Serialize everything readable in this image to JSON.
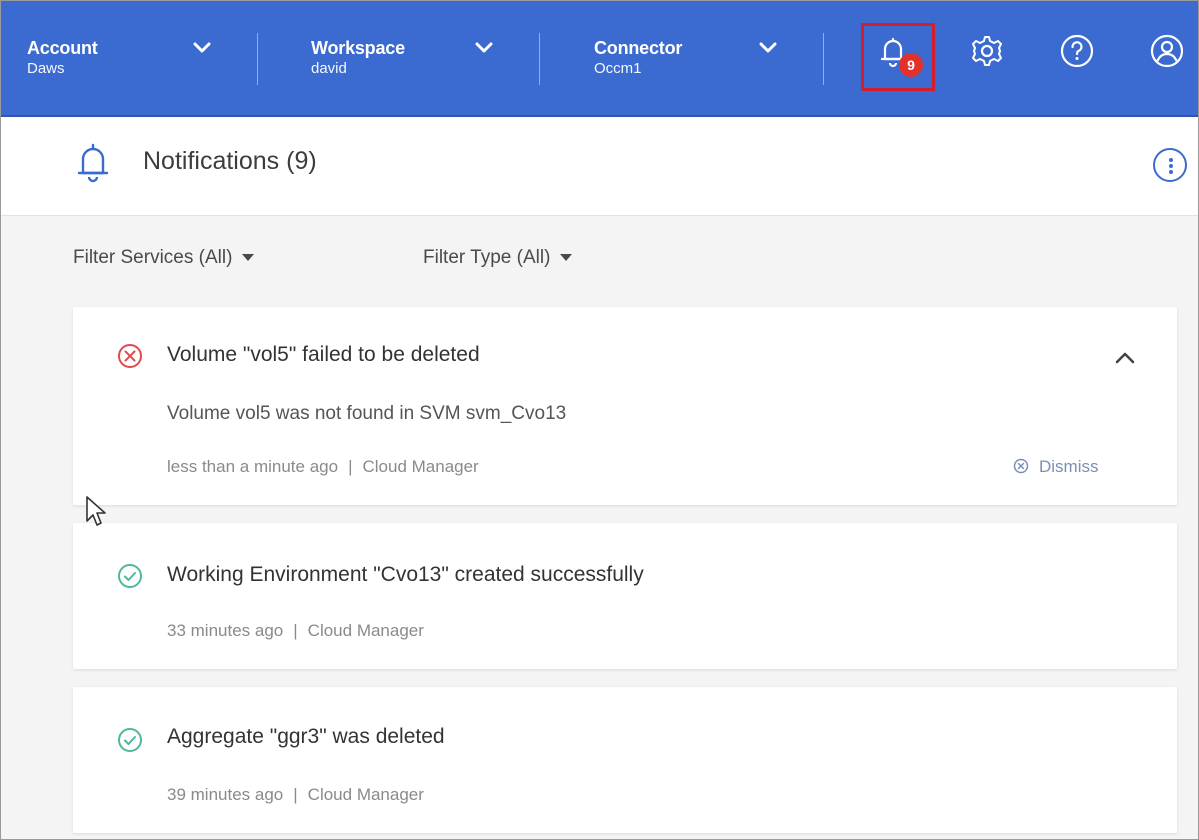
{
  "topbar": {
    "account": {
      "title": "Account",
      "value": "Daws"
    },
    "workspace": {
      "title": "Workspace",
      "value": "david"
    },
    "connector": {
      "title": "Connector",
      "value": "Occm1"
    },
    "notification_count": "9",
    "icons": [
      "bell-icon",
      "gear-icon",
      "help-icon",
      "user-icon"
    ],
    "bar_color": "#3b6bd1",
    "highlight_color": "#d21f2b"
  },
  "header": {
    "title": "Notifications (9)",
    "icon": "bell-icon",
    "menu_icon": "more-options-icon"
  },
  "filters": {
    "services": "Filter Services (All)",
    "type": "Filter Type (All)"
  },
  "notifications": [
    {
      "status": "error",
      "title": "Volume \"vol5\" failed to be deleted",
      "body": "Volume vol5 was not found in SVM svm_Cvo13",
      "time": "less than a minute ago",
      "source": "Cloud Manager",
      "dismiss_label": "Dismiss",
      "expanded": true,
      "status_color": "#e04a4a"
    },
    {
      "status": "success",
      "title": "Working Environment \"Cvo13\" created successfully",
      "time": "33 minutes ago",
      "source": "Cloud Manager",
      "status_color": "#4fb89b"
    },
    {
      "status": "success",
      "title": "Aggregate \"ggr3\" was deleted",
      "time": "39 minutes ago",
      "source": "Cloud Manager",
      "status_color": "#4fb89b"
    }
  ],
  "separator": "|"
}
